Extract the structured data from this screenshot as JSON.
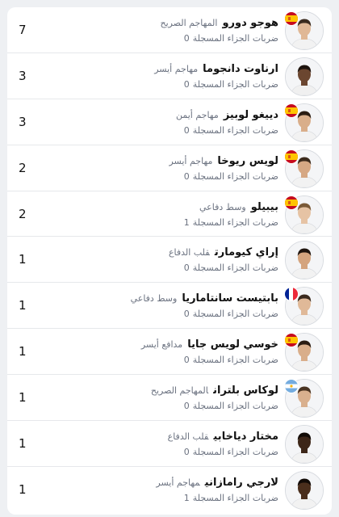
{
  "list_label": "ضربات الجزاء المسجلة",
  "players": [
    {
      "count": "7",
      "name": "هوجو دورو",
      "position": "المهاجم الصريح",
      "penalties": "0",
      "flag": "spain",
      "skin": "#e0b896",
      "hair": "#3a2a1e",
      "shirt": "#f2f2f2"
    },
    {
      "count": "3",
      "name": "ارناوت دانجوما",
      "position": "مهاجم أيسر",
      "penalties": "0",
      "flag": "",
      "skin": "#6b4630",
      "hair": "#1e140e",
      "shirt": "#f0f0f0"
    },
    {
      "count": "3",
      "name": "دييغو لوبيز",
      "position": "مهاجم أيمن",
      "penalties": "0",
      "flag": "spain",
      "skin": "#d9ae8a",
      "hair": "#2a1c12",
      "shirt": "#f2f2f2"
    },
    {
      "count": "2",
      "name": "لويس ريوخا",
      "position": "مهاجم أيسر",
      "penalties": "0",
      "flag": "spain",
      "skin": "#d6a884",
      "hair": "#3b2a1c",
      "shirt": "#f2f2f2"
    },
    {
      "count": "2",
      "name": "بيبيلو",
      "position": "وسط دفاعي",
      "penalties": "1",
      "flag": "spain",
      "skin": "#e6c3a4",
      "hair": "#7a5a38",
      "shirt": "#f2f2f2"
    },
    {
      "count": "1",
      "name": "إراي كيومارت",
      "position": "قلب الدفاع",
      "penalties": "0",
      "flag": "",
      "skin": "#d4a47e",
      "hair": "#1e140e",
      "shirt": "#f2f2f2"
    },
    {
      "count": "1",
      "name": "بابتيست سانتاماريا",
      "position": "وسط دفاعي",
      "penalties": "0",
      "flag": "france",
      "skin": "#e0b998",
      "hair": "#3a2a1e",
      "shirt": "#f2f2f2"
    },
    {
      "count": "1",
      "name": "خوسي لويس جايا",
      "position": "مدافع أيسر",
      "penalties": "0",
      "flag": "spain",
      "skin": "#d9ae8a",
      "hair": "#2a1c12",
      "shirt": "#f2f2f2"
    },
    {
      "count": "1",
      "name": "لوكاس بلتران",
      "position": "المهاجم الصريح",
      "penalties": "0",
      "flag": "argentina",
      "skin": "#d9b08e",
      "hair": "#4a3422",
      "shirt": "#f2f2f2"
    },
    {
      "count": "1",
      "name": "مختار دياخابي",
      "position": "قلب الدفاع",
      "penalties": "0",
      "flag": "",
      "skin": "#3d2618",
      "hair": "#120b07",
      "shirt": "#f2f2f2"
    },
    {
      "count": "1",
      "name": "لارجي رامازاني",
      "position": "مهاجم أيسر",
      "penalties": "1",
      "flag": "",
      "skin": "#4a2e1c",
      "hair": "#120b07",
      "shirt": "#f2f2f2"
    }
  ],
  "colors": {
    "border": "#e6e8eb",
    "muted": "#6b7280",
    "text": "#111111"
  }
}
